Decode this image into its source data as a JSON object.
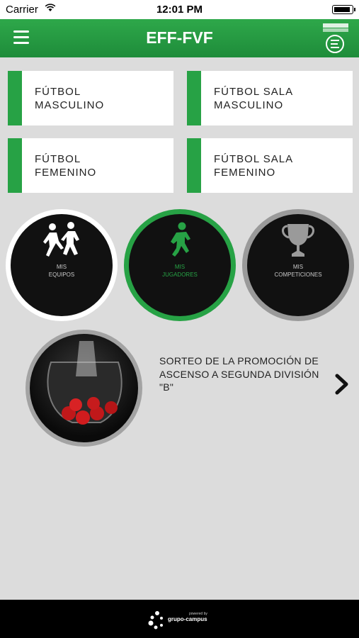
{
  "status_bar": {
    "carrier": "Carrier",
    "time": "12:01 PM"
  },
  "nav": {
    "title": "EFF-FVF"
  },
  "categories": [
    {
      "label": "FÚTBOL\nMASCULINO"
    },
    {
      "label": "FÚTBOL SALA\nMASCULINO"
    },
    {
      "label": "FÚTBOL\nFEMENINO"
    },
    {
      "label": "FÚTBOL SALA\nFEMENINO"
    }
  ],
  "shortcuts": [
    {
      "label": "MIS\nEQUIPOS",
      "icon": "players-running-icon"
    },
    {
      "label": "MIS\nJUGADORES",
      "icon": "player-icon",
      "active": true
    },
    {
      "label": "MIS\nCOMPETICIONES",
      "icon": "trophy-icon"
    }
  ],
  "news": {
    "title": "SORTEO DE LA PROMOCIÓN DE ASCENSO A SEGUNDA DIVISIÓN \"B\""
  },
  "footer": {
    "powered": "powered by",
    "brand": "grupo-campus"
  },
  "colors": {
    "accent": "#27a245",
    "nav": "#1e8c3a",
    "background": "#dcdcdc"
  }
}
